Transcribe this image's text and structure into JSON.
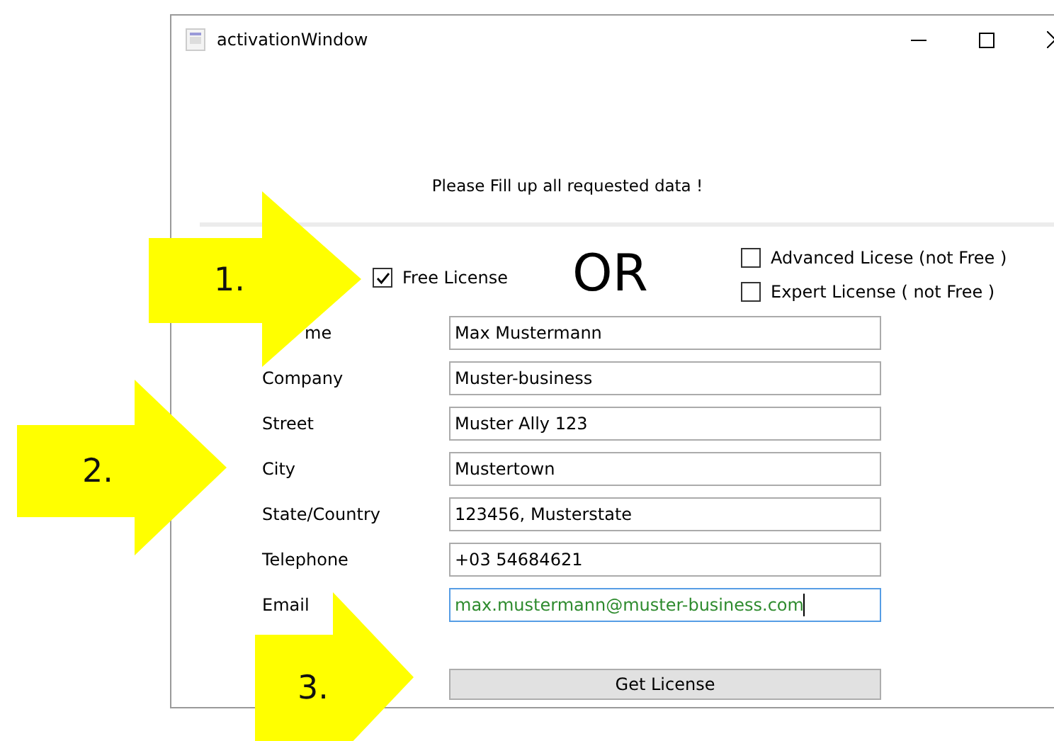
{
  "window": {
    "title": "activationWindow"
  },
  "header": {
    "message": "Please Fill up all requested data !"
  },
  "license_options": [
    {
      "label": "Free License",
      "checked": true
    },
    {
      "label": "Advanced Licese (not Free )",
      "checked": false
    },
    {
      "label": "Expert License ( not Free )",
      "checked": false
    }
  ],
  "separator_text": "OR",
  "fields": [
    {
      "label": "me",
      "value": "Max Mustermann",
      "focused": false
    },
    {
      "label": "Company",
      "value": "Muster-business",
      "focused": false
    },
    {
      "label": "Street",
      "value": "Muster Ally 123",
      "focused": false
    },
    {
      "label": "City",
      "value": "Mustertown",
      "focused": false
    },
    {
      "label": "State/Country",
      "value": "123456, Musterstate",
      "focused": false
    },
    {
      "label": "Telephone",
      "value": "+03 54684621",
      "focused": false
    },
    {
      "label": "Email",
      "value": "max.mustermann@muster-business.com",
      "focused": true
    }
  ],
  "button": "Get License",
  "callouts": [
    "1.",
    "2.",
    "3."
  ]
}
